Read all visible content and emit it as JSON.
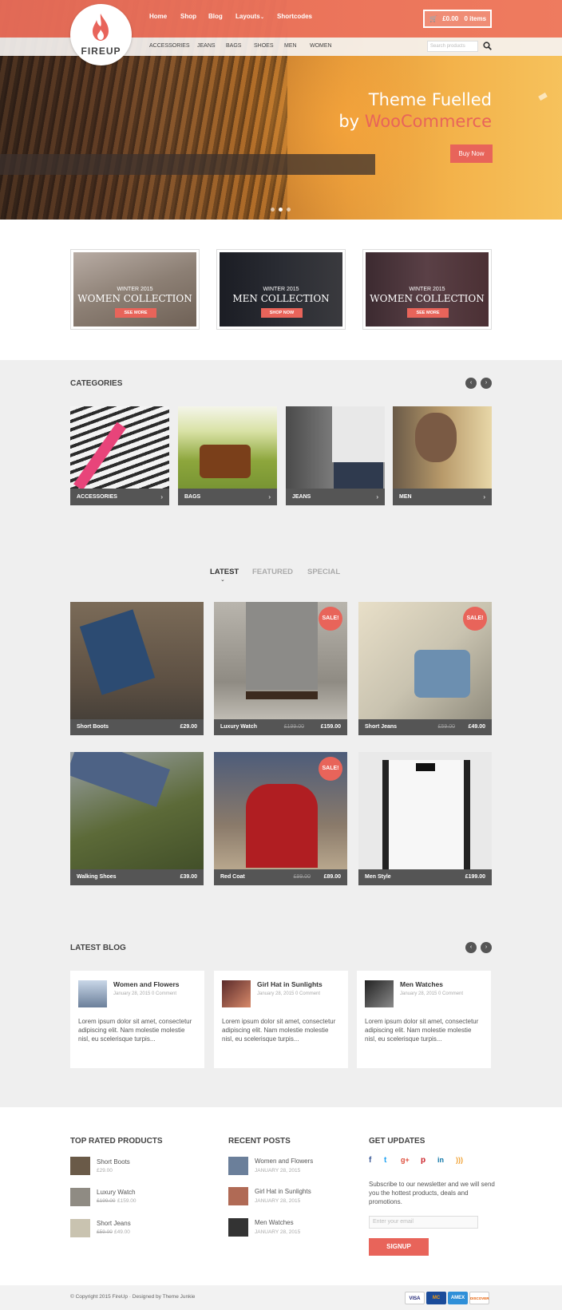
{
  "header": {
    "logo_text": "FIREUP",
    "main_nav": [
      "Home",
      "Shop",
      "Blog",
      "Layouts",
      "Shortcodes"
    ],
    "cart_label": "£0.00",
    "cart_items": "0 items",
    "sub_nav": [
      "ACCESSORIES",
      "JEANS",
      "BAGS",
      "SHOES",
      "MEN",
      "WOMEN"
    ],
    "search_placeholder": "Search products"
  },
  "hero": {
    "title_line1": "Theme Fuelled",
    "title_line2_prefix": "by ",
    "title_line2_brand": "WooCommerce",
    "button": "Buy Now",
    "slides": 3,
    "active_slide": 2
  },
  "promos": [
    {
      "season": "WINTER 2015",
      "title": "WOMEN COLLECTION",
      "button": "SEE MORE"
    },
    {
      "season": "WINTER 2015",
      "title": "MEN COLLECTION",
      "button": "SHOP NOW"
    },
    {
      "season": "WINTER 2015",
      "title": "WOMEN COLLECTION",
      "button": "SEE MORE"
    }
  ],
  "categories": {
    "heading": "CATEGORIES",
    "items": [
      "ACCESSORIES",
      "BAGS",
      "JEANS",
      "MEN"
    ]
  },
  "products": {
    "tabs": [
      "LATEST",
      "FEATURED",
      "SPECIAL"
    ],
    "active_tab": "LATEST",
    "sale_badge": "SALE!",
    "items": [
      {
        "name": "Short Boots",
        "old_price": "",
        "price": "£29.00",
        "sale": false
      },
      {
        "name": "Luxury Watch",
        "old_price": "£199.00",
        "price": "£159.00",
        "sale": true
      },
      {
        "name": "Short Jeans",
        "old_price": "£59.00",
        "price": "£49.00",
        "sale": true
      },
      {
        "name": "Walking Shoes",
        "old_price": "",
        "price": "£39.00",
        "sale": false
      },
      {
        "name": "Red Coat",
        "old_price": "£99.00",
        "price": "£89.00",
        "sale": true
      },
      {
        "name": "Men Style",
        "old_price": "",
        "price": "£199.00",
        "sale": false
      }
    ]
  },
  "blog": {
    "heading": "LATEST BLOG",
    "posts": [
      {
        "title": "Women and Flowers",
        "meta": "January 28, 2015  0 Comment",
        "excerpt": "Lorem ipsum dolor sit amet, consectetur adipiscing elit. Nam molestie molestie nisl, eu scelerisque turpis..."
      },
      {
        "title": "Girl Hat in Sunlights",
        "meta": "January 28, 2015  0 Comment",
        "excerpt": "Lorem ipsum dolor sit amet, consectetur adipiscing elit. Nam molestie molestie nisl, eu scelerisque turpis..."
      },
      {
        "title": "Men Watches",
        "meta": "January 28, 2015  0 Comment",
        "excerpt": "Lorem ipsum dolor sit amet, consectetur adipiscing elit. Nam molestie molestie nisl, eu scelerisque turpis..."
      }
    ]
  },
  "footer": {
    "top_rated": {
      "heading": "TOP RATED PRODUCTS",
      "items": [
        {
          "name": "Short Boots",
          "old_price": "",
          "price": "£29.00"
        },
        {
          "name": "Luxury Watch",
          "old_price": "£199.00",
          "price": "£159.00"
        },
        {
          "name": "Short Jeans",
          "old_price": "£59.00",
          "price": "£49.00"
        }
      ]
    },
    "recent_posts": {
      "heading": "RECENT POSTS",
      "items": [
        {
          "title": "Women and Flowers",
          "date": "JANUARY 28, 2015"
        },
        {
          "title": "Girl Hat in Sunlights",
          "date": "JANUARY 28, 2015"
        },
        {
          "title": "Men Watches",
          "date": "JANUARY 28, 2015"
        }
      ]
    },
    "updates": {
      "heading": "GET UPDATES",
      "social": [
        "facebook",
        "twitter",
        "google-plus",
        "pinterest",
        "linkedin",
        "rss"
      ],
      "text": "Subscribe to our newsletter and we will send you the hottest products, deals and promotions.",
      "email_placeholder": "Enter your email",
      "button": "SIGNUP"
    },
    "copyright": "© Copyright 2015 FireUp · Designed by Theme Junkie",
    "payment": [
      "VISA",
      "MC",
      "AMEX",
      "DISCOVER"
    ]
  },
  "colors": {
    "accent": "#e8645a",
    "dark_bar": "#555555",
    "section_gray": "#efefef"
  }
}
